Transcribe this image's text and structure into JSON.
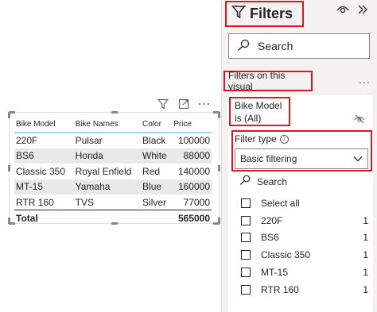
{
  "visual": {
    "columns": [
      "Bike Model",
      "Bike Names",
      "Color",
      "Price"
    ],
    "rows": [
      [
        "220F",
        "Pulsar",
        "Black",
        "100000"
      ],
      [
        "BS6",
        "Honda",
        "White",
        "88000"
      ],
      [
        "Classic 350",
        "Royal Enfield",
        "Red",
        "140000"
      ],
      [
        "MT-15",
        "Yamaha",
        "Blue",
        "160000"
      ],
      [
        "RTR 160",
        "TVS",
        "Silver",
        "77000"
      ]
    ],
    "total_label": "Total",
    "total_value": "565000"
  },
  "pane": {
    "title": "Filters",
    "search_placeholder": "Search",
    "section_label": "Filters on this visual",
    "more": "...",
    "field_line1": "Bike Model",
    "field_line2": "is (All)",
    "filter_type_label": "Filter type",
    "filter_type_value": "Basic filtering",
    "list_search_placeholder": "Search",
    "items": [
      {
        "label": "Select all",
        "count": ""
      },
      {
        "label": "220F",
        "count": "1"
      },
      {
        "label": "BS6",
        "count": "1"
      },
      {
        "label": "Classic 350",
        "count": "1"
      },
      {
        "label": "MT-15",
        "count": "1"
      },
      {
        "label": "RTR 160",
        "count": "1"
      }
    ]
  },
  "colors": {
    "highlight_border": "#e0161e",
    "header_underline": "#a8d5f6",
    "alt_row": "#e9e9e9",
    "pane_bg": "#f3f2f1"
  },
  "icons": [
    "filter-icon",
    "focus-mode-icon",
    "more-options-icon",
    "eye-icon",
    "collapse-pane-icon",
    "search-icon",
    "eye-off-icon",
    "info-icon",
    "chevron-down-icon"
  ]
}
